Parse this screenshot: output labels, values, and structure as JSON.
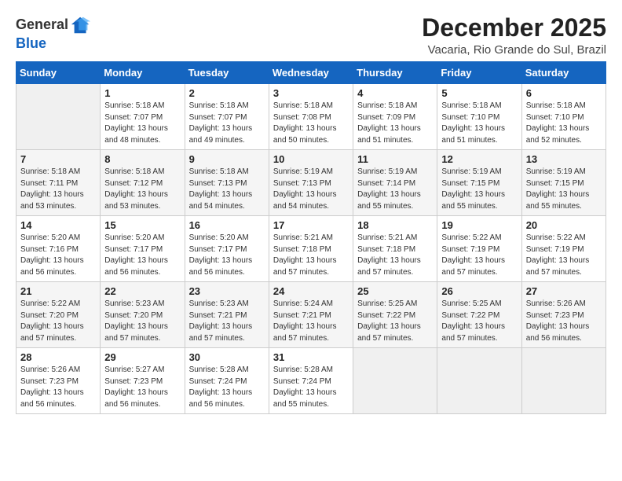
{
  "header": {
    "logo_general": "General",
    "logo_blue": "Blue",
    "month": "December 2025",
    "location": "Vacaria, Rio Grande do Sul, Brazil"
  },
  "days_of_week": [
    "Sunday",
    "Monday",
    "Tuesday",
    "Wednesday",
    "Thursday",
    "Friday",
    "Saturday"
  ],
  "weeks": [
    [
      {
        "day": "",
        "info": ""
      },
      {
        "day": "1",
        "info": "Sunrise: 5:18 AM\nSunset: 7:07 PM\nDaylight: 13 hours\nand 48 minutes."
      },
      {
        "day": "2",
        "info": "Sunrise: 5:18 AM\nSunset: 7:07 PM\nDaylight: 13 hours\nand 49 minutes."
      },
      {
        "day": "3",
        "info": "Sunrise: 5:18 AM\nSunset: 7:08 PM\nDaylight: 13 hours\nand 50 minutes."
      },
      {
        "day": "4",
        "info": "Sunrise: 5:18 AM\nSunset: 7:09 PM\nDaylight: 13 hours\nand 51 minutes."
      },
      {
        "day": "5",
        "info": "Sunrise: 5:18 AM\nSunset: 7:10 PM\nDaylight: 13 hours\nand 51 minutes."
      },
      {
        "day": "6",
        "info": "Sunrise: 5:18 AM\nSunset: 7:10 PM\nDaylight: 13 hours\nand 52 minutes."
      }
    ],
    [
      {
        "day": "7",
        "info": "Sunrise: 5:18 AM\nSunset: 7:11 PM\nDaylight: 13 hours\nand 53 minutes."
      },
      {
        "day": "8",
        "info": "Sunrise: 5:18 AM\nSunset: 7:12 PM\nDaylight: 13 hours\nand 53 minutes."
      },
      {
        "day": "9",
        "info": "Sunrise: 5:18 AM\nSunset: 7:13 PM\nDaylight: 13 hours\nand 54 minutes."
      },
      {
        "day": "10",
        "info": "Sunrise: 5:19 AM\nSunset: 7:13 PM\nDaylight: 13 hours\nand 54 minutes."
      },
      {
        "day": "11",
        "info": "Sunrise: 5:19 AM\nSunset: 7:14 PM\nDaylight: 13 hours\nand 55 minutes."
      },
      {
        "day": "12",
        "info": "Sunrise: 5:19 AM\nSunset: 7:15 PM\nDaylight: 13 hours\nand 55 minutes."
      },
      {
        "day": "13",
        "info": "Sunrise: 5:19 AM\nSunset: 7:15 PM\nDaylight: 13 hours\nand 55 minutes."
      }
    ],
    [
      {
        "day": "14",
        "info": "Sunrise: 5:20 AM\nSunset: 7:16 PM\nDaylight: 13 hours\nand 56 minutes."
      },
      {
        "day": "15",
        "info": "Sunrise: 5:20 AM\nSunset: 7:17 PM\nDaylight: 13 hours\nand 56 minutes."
      },
      {
        "day": "16",
        "info": "Sunrise: 5:20 AM\nSunset: 7:17 PM\nDaylight: 13 hours\nand 56 minutes."
      },
      {
        "day": "17",
        "info": "Sunrise: 5:21 AM\nSunset: 7:18 PM\nDaylight: 13 hours\nand 57 minutes."
      },
      {
        "day": "18",
        "info": "Sunrise: 5:21 AM\nSunset: 7:18 PM\nDaylight: 13 hours\nand 57 minutes."
      },
      {
        "day": "19",
        "info": "Sunrise: 5:22 AM\nSunset: 7:19 PM\nDaylight: 13 hours\nand 57 minutes."
      },
      {
        "day": "20",
        "info": "Sunrise: 5:22 AM\nSunset: 7:19 PM\nDaylight: 13 hours\nand 57 minutes."
      }
    ],
    [
      {
        "day": "21",
        "info": "Sunrise: 5:22 AM\nSunset: 7:20 PM\nDaylight: 13 hours\nand 57 minutes."
      },
      {
        "day": "22",
        "info": "Sunrise: 5:23 AM\nSunset: 7:20 PM\nDaylight: 13 hours\nand 57 minutes."
      },
      {
        "day": "23",
        "info": "Sunrise: 5:23 AM\nSunset: 7:21 PM\nDaylight: 13 hours\nand 57 minutes."
      },
      {
        "day": "24",
        "info": "Sunrise: 5:24 AM\nSunset: 7:21 PM\nDaylight: 13 hours\nand 57 minutes."
      },
      {
        "day": "25",
        "info": "Sunrise: 5:25 AM\nSunset: 7:22 PM\nDaylight: 13 hours\nand 57 minutes."
      },
      {
        "day": "26",
        "info": "Sunrise: 5:25 AM\nSunset: 7:22 PM\nDaylight: 13 hours\nand 57 minutes."
      },
      {
        "day": "27",
        "info": "Sunrise: 5:26 AM\nSunset: 7:23 PM\nDaylight: 13 hours\nand 56 minutes."
      }
    ],
    [
      {
        "day": "28",
        "info": "Sunrise: 5:26 AM\nSunset: 7:23 PM\nDaylight: 13 hours\nand 56 minutes."
      },
      {
        "day": "29",
        "info": "Sunrise: 5:27 AM\nSunset: 7:23 PM\nDaylight: 13 hours\nand 56 minutes."
      },
      {
        "day": "30",
        "info": "Sunrise: 5:28 AM\nSunset: 7:24 PM\nDaylight: 13 hours\nand 56 minutes."
      },
      {
        "day": "31",
        "info": "Sunrise: 5:28 AM\nSunset: 7:24 PM\nDaylight: 13 hours\nand 55 minutes."
      },
      {
        "day": "",
        "info": ""
      },
      {
        "day": "",
        "info": ""
      },
      {
        "day": "",
        "info": ""
      }
    ]
  ]
}
